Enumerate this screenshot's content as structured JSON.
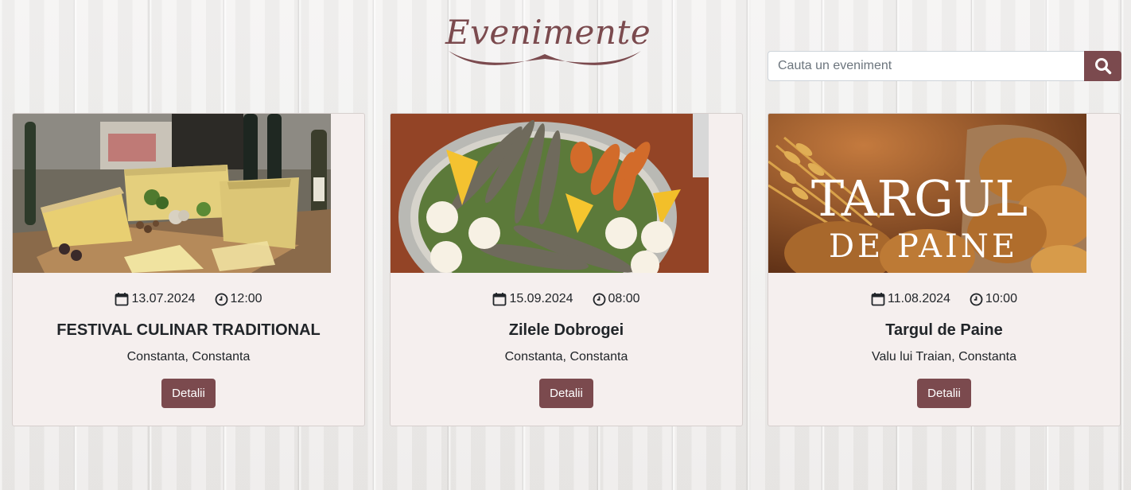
{
  "header": {
    "logo_text": "Evenimente"
  },
  "search": {
    "placeholder": "Cauta un eveniment",
    "value": "",
    "button_icon": "search-icon"
  },
  "colors": {
    "accent": "#7b4a4e",
    "card_background": "#f5efee"
  },
  "events": [
    {
      "date": "13.07.2024",
      "time": "12:00",
      "title": "FESTIVAL CULINAR TRADITIONAL",
      "location": "Constanta, Constanta",
      "button_label": "Detalii",
      "image": "cheese-platter"
    },
    {
      "date": "15.09.2024",
      "time": "08:00",
      "title": "Zilele Dobrogei",
      "location": "Constanta, Constanta",
      "button_label": "Detalii",
      "image": "fish-platter"
    },
    {
      "date": "11.08.2024",
      "time": "10:00",
      "title": "Targul de Paine",
      "location": "Valu lui Traian, Constanta",
      "button_label": "Detalii",
      "image": "bread-poster",
      "image_text_line1": "TARGUL",
      "image_text_line2": "DE PAINE"
    }
  ]
}
